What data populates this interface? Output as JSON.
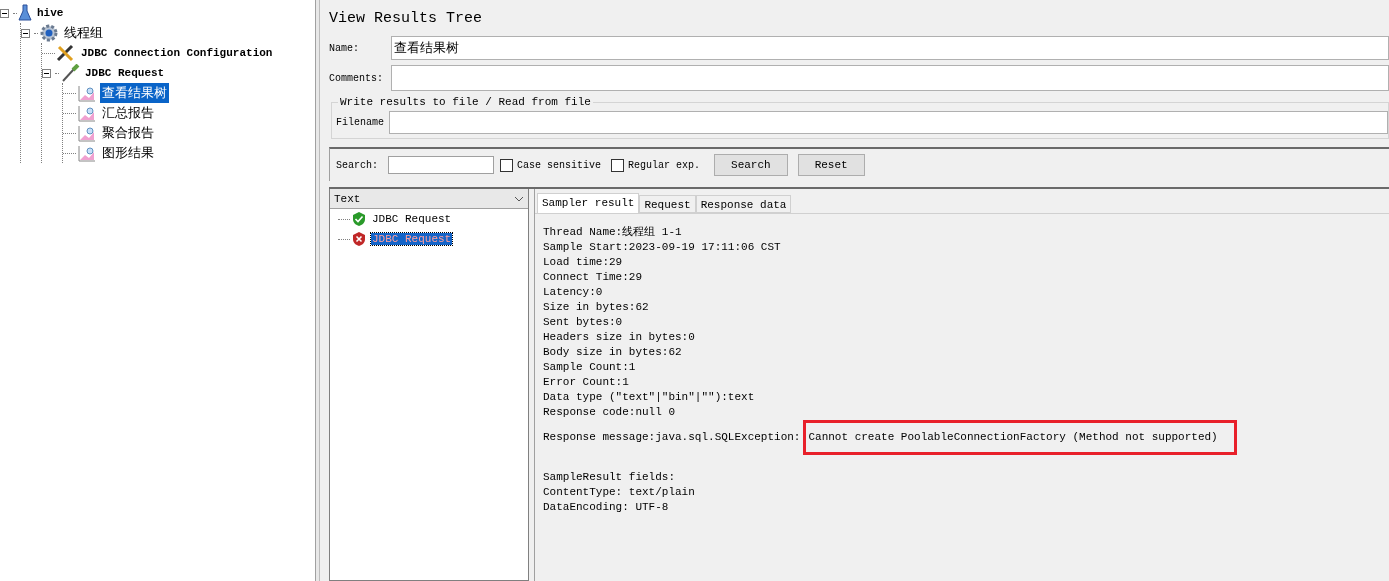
{
  "tree": [
    {
      "label": "hive",
      "kind": "flask",
      "expanded": true,
      "selected": false,
      "children": [
        {
          "label": "线程组",
          "kind": "gear",
          "expanded": true,
          "selected": false,
          "children": [
            {
              "label": "JDBC Connection Configuration",
              "kind": "tools",
              "selected": false
            },
            {
              "label": "JDBC Request",
              "kind": "pipette",
              "expanded": true,
              "selected": false,
              "children": [
                {
                  "label": "查看结果树",
                  "kind": "chart",
                  "selected": true
                },
                {
                  "label": "汇总报告",
                  "kind": "chart",
                  "selected": false
                },
                {
                  "label": "聚合报告",
                  "kind": "chart",
                  "selected": false
                },
                {
                  "label": "图形结果",
                  "kind": "chart",
                  "selected": false
                }
              ]
            }
          ]
        }
      ]
    }
  ],
  "panel": {
    "title": "View Results Tree",
    "name_label": "Name:",
    "name_value": "查看结果树",
    "comments_label": "Comments:",
    "file_group": "Write results to file / Read from file",
    "filename_label": "Filename"
  },
  "search": {
    "label": "Search:",
    "case_sensitive": {
      "label": "Case sensitive",
      "checked": false
    },
    "regular_exp": {
      "label": "Regular exp.",
      "checked": false
    },
    "search_button": "Search",
    "reset_button": "Reset"
  },
  "renderer": {
    "value": "Text"
  },
  "results": [
    {
      "label": "JDBC Request",
      "kind": "pass",
      "selected": false
    },
    {
      "label": "JDBC Request",
      "kind": "fail",
      "selected": true
    }
  ],
  "tabs": [
    {
      "label": "Sampler result",
      "selected": true
    },
    {
      "label": "Request",
      "selected": false
    },
    {
      "label": "Response data",
      "selected": false
    }
  ],
  "sampler_lines": [
    {
      "text": "Thread Name:线程组 1-1"
    },
    {
      "text": "Sample Start:2023-09-19 17:11:06 CST"
    },
    {
      "text": "Load time:29"
    },
    {
      "text": "Connect Time:29"
    },
    {
      "text": "Latency:0"
    },
    {
      "text": "Size in bytes:62"
    },
    {
      "text": "Sent bytes:0"
    },
    {
      "text": "Headers size in bytes:0"
    },
    {
      "text": "Body size in bytes:62"
    },
    {
      "text": "Sample Count:1"
    },
    {
      "text": "Error Count:1"
    },
    {
      "text": "Data type (\"text\"|\"bin\"|\"\"):text"
    },
    {
      "text": "Response code:null 0"
    },
    {
      "text": "Response message:java.sql.SQLException:",
      "highlight": "Cannot create PoolableConnectionFactory (Method not supported)"
    }
  ],
  "field_lines": [
    "SampleResult fields:",
    "ContentType: text/plain",
    "DataEncoding: UTF-8"
  ]
}
